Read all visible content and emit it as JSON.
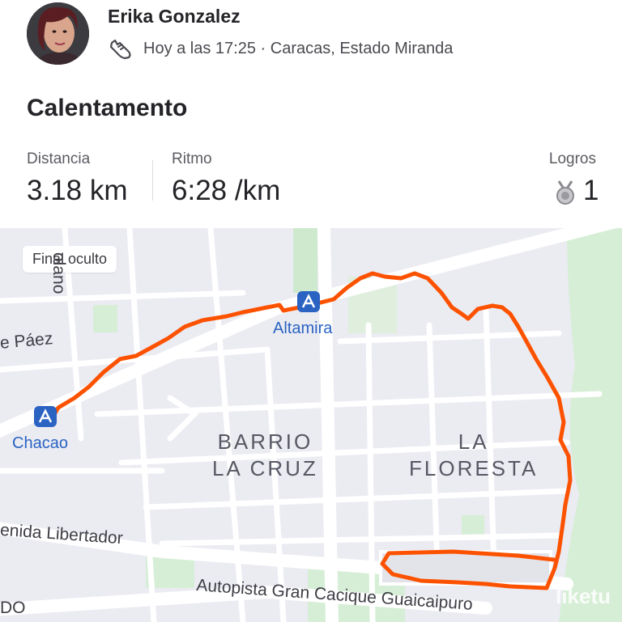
{
  "header": {
    "user_name": "Erika Gonzalez",
    "activity_meta": "Hoy a las 17:25 · Caracas, Estado Miranda",
    "activity_icon": "shoe-icon"
  },
  "activity": {
    "title": "Calentamento"
  },
  "stats": {
    "distance": {
      "label": "Distancia",
      "value": "3.18 km"
    },
    "pace": {
      "label": "Ritmo",
      "value": "6:28 /km"
    },
    "achievements": {
      "label": "Logros",
      "value": "1",
      "icon": "medal-icon"
    }
  },
  "map": {
    "privacy_chip": "Final oculto",
    "stations": [
      {
        "name": "Altamira"
      },
      {
        "name": "Chacao"
      }
    ],
    "areas": [
      {
        "name": "BARRIO\nLA CRUZ"
      },
      {
        "name": "LA\nFLORESTA"
      }
    ],
    "roads": [
      "e Páez",
      "enida Libertador",
      "Autopista Gran Cacique Guaicaipuro",
      "olano",
      "DO"
    ],
    "route_color": "#fc5200",
    "watermark": "liketu"
  }
}
